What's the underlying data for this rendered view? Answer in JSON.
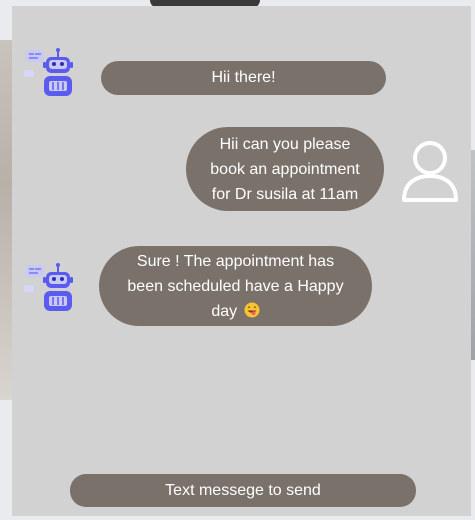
{
  "chat": {
    "messages": [
      {
        "sender": "bot",
        "text": "Hii there!"
      },
      {
        "sender": "user",
        "lines": [
          "Hii can you please",
          "book an appointment",
          "for Dr susila at 11am"
        ]
      },
      {
        "sender": "bot",
        "lines": [
          "Sure ! The appointment has",
          "been scheduled have a Happy",
          "day"
        ],
        "emoji": "smiling-face-with-tongue"
      }
    ]
  },
  "composer": {
    "placeholder": "Text messege to send"
  },
  "icons": {
    "bot_avatar": "robot-icon",
    "user_avatar": "user-icon"
  },
  "colors": {
    "panel_bg": "#d2d2d2",
    "bubble_bg": "#7a726a",
    "bubble_text": "#ffffff",
    "robot_accent": "#5b5bf0"
  }
}
